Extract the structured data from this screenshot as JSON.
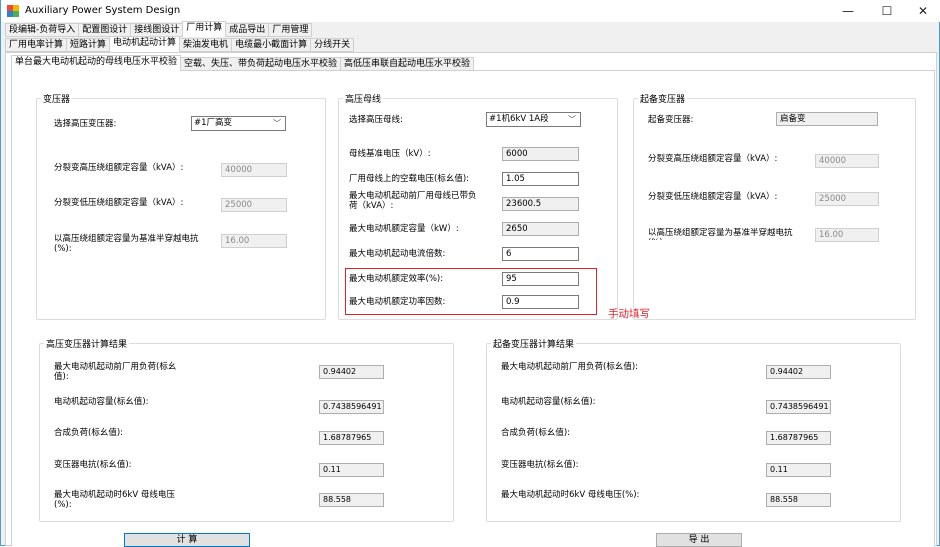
{
  "window": {
    "title": "Auxiliary Power System Design",
    "minimize": "—",
    "maximize": "☐",
    "close": "✕"
  },
  "menu_tabs": [
    "段编辑-负荷导入",
    "配置图设计",
    "接线图设计",
    "厂用计算",
    "成品导出",
    "厂用管理"
  ],
  "sub_tabs": [
    "厂用电率计算",
    "短路计算",
    "电动机起动计算",
    "柴油发电机",
    "电缆最小截面计算",
    "分线开关"
  ],
  "check_tabs": [
    "单台最大电动机起动的母线电压水平校验",
    "空载、失压、带负荷起动电压水平校验",
    "高低压串联自起动电压水平校验"
  ],
  "transformer": {
    "title": "变压器",
    "select_label": "选择高压变压器:",
    "select_value": "#1厂高变",
    "hv_cap_label": "分裂变高压绕组额定容量（kVA）:",
    "hv_cap": "40000",
    "lv_cap_label": "分裂变低压绕组额定容量（kVA）:",
    "lv_cap": "25000",
    "reactance_label": "以高压绕组额定容量为基准半穿越电抗(%):",
    "reactance": "16.00"
  },
  "bus": {
    "title": "高压母线",
    "select_label": "选择高压母线:",
    "select_value": "#1机6kV 1A段",
    "base_v_label": "母线基准电压（kV）:",
    "base_v": "6000",
    "noload_v_label": "厂用母线上的空载电压(标幺值):",
    "noload_v": "1.05",
    "load_label": "最大电动机起动前厂用母线已带负荷（kVA）:",
    "load": "23600.5",
    "motor_cap_label": "最大电动机额定容量（kW）:",
    "motor_cap": "2650",
    "start_mult_label": "最大电动机起动电流倍数:",
    "start_mult": "6",
    "eff_label": "最大电动机额定效率(%):",
    "eff": "95",
    "pf_label": "最大电动机额定功率因数:",
    "pf": "0.9",
    "note": "手动填写"
  },
  "standby": {
    "title": "起备变压器",
    "name_label": "起备变压器:",
    "name": "启备变",
    "hv_cap_label": "分裂变高压绕组额定容量（kVA）:",
    "hv_cap": "40000",
    "lv_cap_label": "分裂变低压绕组额定容量（kVA）:",
    "lv_cap": "25000",
    "reactance_label": "以高压绕组额定容量为基准半穿越电抗(%):",
    "reactance": "16.00"
  },
  "results": [
    {
      "title": "高压变压器计算结果",
      "rows": [
        {
          "label": "最大电动机起动前厂用负荷(标幺值):",
          "value": "0.94402"
        },
        {
          "label": "电动机起动容量(标幺值):",
          "value": "0.7438596491"
        },
        {
          "label": "合成负荷(标幺值):",
          "value": "1.68787965"
        },
        {
          "label": "变压器电抗(标幺值):",
          "value": "0.11"
        },
        {
          "label": "最大电动机起动时6kV 母线电压(%):",
          "value": "88.558"
        }
      ]
    },
    {
      "title": "起备变压器计算结果",
      "rows": [
        {
          "label": "最大电动机起动前厂用负荷(标幺值):",
          "value": "0.94402"
        },
        {
          "label": "电动机起动容量(标幺值):",
          "value": "0.7438596491"
        },
        {
          "label": "合成负荷(标幺值):",
          "value": "1.68787965"
        },
        {
          "label": "变压器电抗(标幺值):",
          "value": "0.11"
        },
        {
          "label": "最大电动机起动时6kV 母线电压(%):",
          "value": "88.558"
        }
      ]
    }
  ],
  "buttons": {
    "calc": "计 算",
    "export": "导 出"
  },
  "colors": {
    "accent": "#0078d7",
    "highlight": "#e8202a"
  }
}
